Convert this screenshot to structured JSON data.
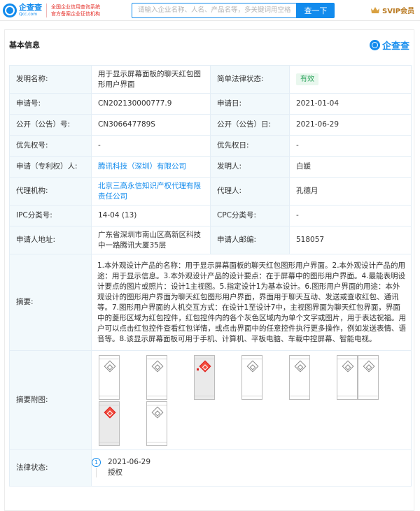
{
  "header": {
    "logo_cn": "企查查",
    "logo_en": "Qcc.com",
    "slogan_line1": "全国企业信用查询系统",
    "slogan_line2": "官方备案企业征信机构",
    "search_placeholder": "请输入企业名称、人名、产品名等，多关键词用空格隔开",
    "search_button": "查一下",
    "svip_label": "SVIP会员",
    "accent": "#128bed"
  },
  "section": {
    "title": "基本信息",
    "brand": "企查查"
  },
  "fields": {
    "invention_name_label": "发明名称:",
    "invention_name": "用于显示屏幕面板的聊天红包图形用户界面",
    "legal_status_simple_label": "简单法律状态:",
    "legal_status_simple": "有效",
    "app_no_label": "申请号:",
    "app_no": "CN202130000777.9",
    "app_date_label": "申请日:",
    "app_date": "2021-01-04",
    "pub_no_label": "公开（公告）号:",
    "pub_no": "CN306647789S",
    "pub_date_label": "公开（公告）日:",
    "pub_date": "2021-06-29",
    "priority_no_label": "优先权号:",
    "priority_no": "-",
    "priority_date_label": "优先权日:",
    "priority_date": "-",
    "applicant_label": "申请（专利权）人:",
    "applicant": "腾讯科技（深圳）有限公司",
    "inventor_label": "发明人:",
    "inventor": "白媛",
    "agency_label": "代理机构:",
    "agency": "北京三高永信知识产权代理有限责任公司",
    "agent_label": "代理人:",
    "agent": "孔德月",
    "ipc_label": "IPC分类号:",
    "ipc": "14-04 (13)",
    "cpc_label": "CPC分类号:",
    "cpc": "-",
    "address_label": "申请人地址:",
    "address": "广东省深圳市南山区高新区科技中一路腾讯大厦35层",
    "postcode_label": "申请人邮编:",
    "postcode": "518057",
    "abstract_label": "摘要:",
    "abstract": "1.本外观设计产品的名称：用于显示屏幕面板的聊天红包图形用户界面。2.本外观设计产品的用途：用于显示信息。3.本外观设计产品的设计要点：在于屏幕中的图形用户界面。4.最能表明设计要点的图片或照片：设计1主视图。5.指定设计1为基本设计。6.图形用户界面的用途：本外观设计的图形用户界面为聊天红包图形用户界面，界面用于聊天互动、发送或查收红包、通讯等。7.图形用户界面的人机交互方式：在设计1至设计7中，主视图界面为聊天红包界面，界面中的菱形区域为红包控件，红包控件内的各个灰色区域内为单个文字或图片，用于表达祝福。用户可以点击红包控件查看红包详情，或点击界面中的任意控件执行更多操作，例如发送表情、语音等。8.该显示屏幕面板可用于手机、计算机、平板电脑、车载中控屏幕、智能电视。",
    "figures_label": "摘要附图:",
    "legal_status_label": "法律状态:"
  },
  "figures": [
    {
      "style": "plain"
    },
    {
      "style": "plain"
    },
    {
      "style": "red"
    },
    {
      "style": "plain"
    },
    {
      "style": "plain"
    },
    {
      "style": "plain"
    },
    {
      "style": "plain"
    },
    {
      "style": "red-grey"
    },
    {
      "style": "plain"
    }
  ],
  "legal_events": [
    {
      "index": "1",
      "date": "2021-06-29",
      "desc": "授权"
    }
  ]
}
